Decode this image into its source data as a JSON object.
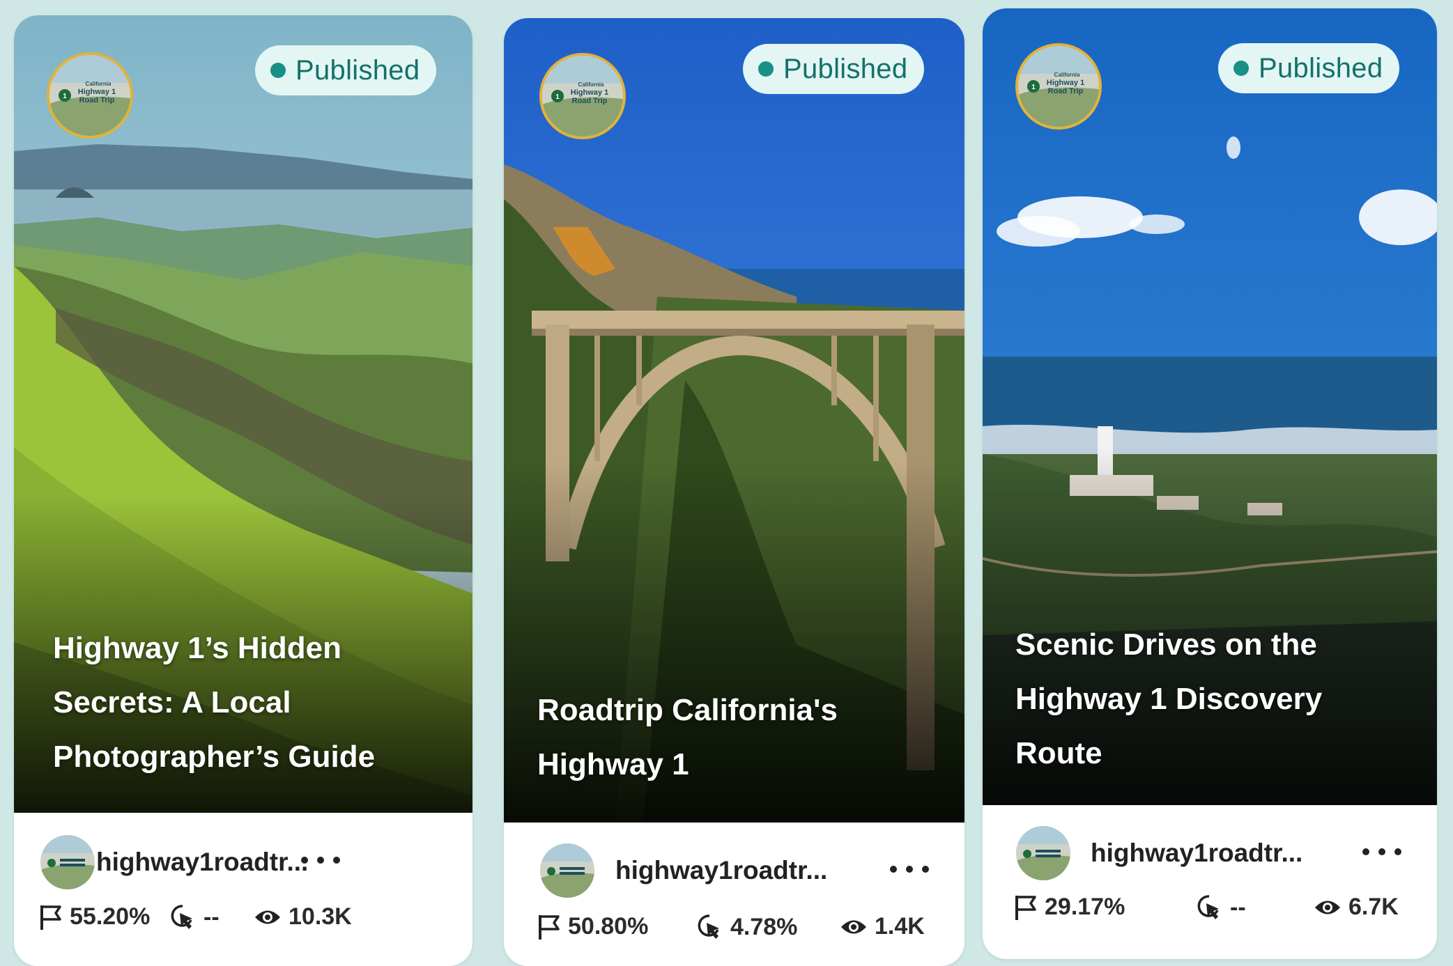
{
  "cards": [
    {
      "status": "Published",
      "title_lines": [
        "Highway 1’s Hidden",
        "Secrets: A Local",
        "Photographer’s Guide"
      ],
      "handle": "highway1roadtr...",
      "completion": "55.20%",
      "ctr": "--",
      "views": "10.3K"
    },
    {
      "status": "Published",
      "title_lines": [
        "Roadtrip California's",
        "Highway 1"
      ],
      "handle": "highway1roadtr...",
      "completion": "50.80%",
      "ctr": "4.78%",
      "views": "1.4K"
    },
    {
      "status": "Published",
      "title_lines": [
        "Scenic Drives on the",
        "Highway 1 Discovery",
        "Route"
      ],
      "handle": "highway1roadtr...",
      "completion": "29.17%",
      "ctr": "--",
      "views": "6.7K"
    }
  ],
  "logo_text": {
    "top": "California",
    "line1": "Highway 1",
    "line2": "Road Trip"
  },
  "icons": {
    "completion": "flag-icon",
    "ctr": "cursor-click-icon",
    "views": "eye-icon",
    "more": "more-dots-icon"
  },
  "colors": {
    "status_dot": "#1a8f86",
    "status_text": "#13716a",
    "status_bg": "#e3f6f4",
    "logo_ring": "#e2b23a",
    "page_bg": "#cfe8e6"
  }
}
